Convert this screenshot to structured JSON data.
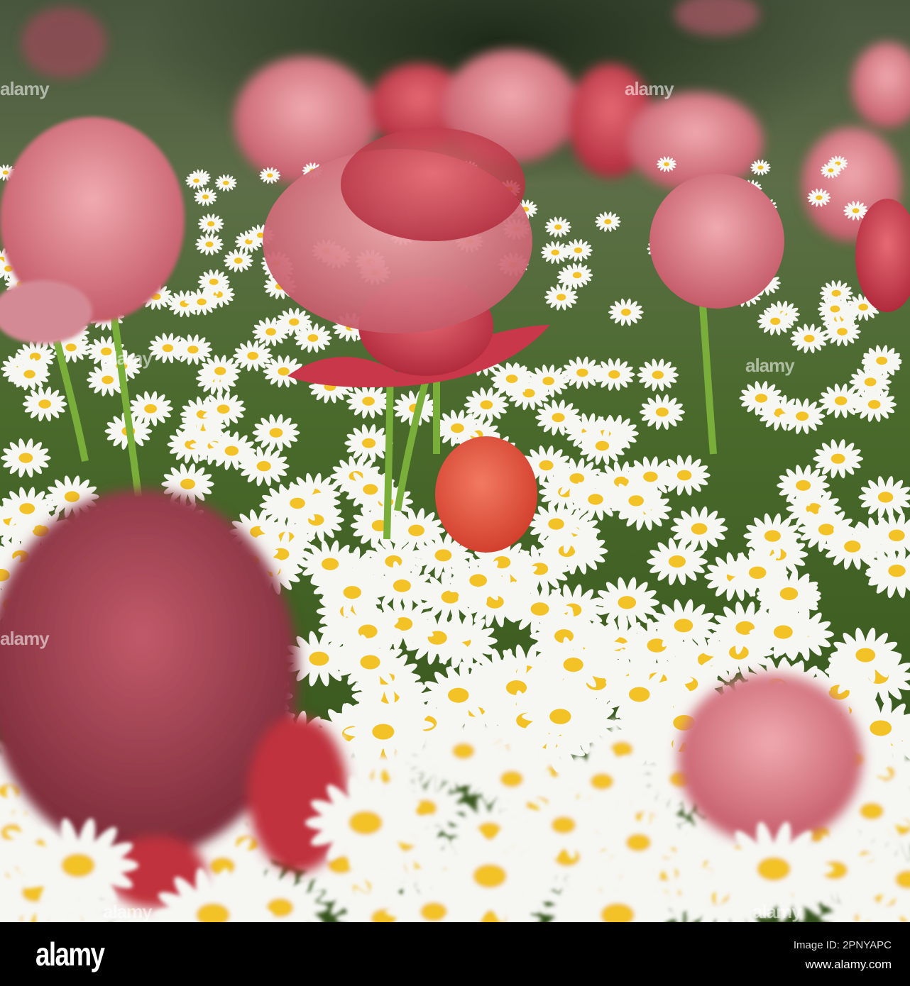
{
  "photo": {
    "subject": "tulips-and-daisies",
    "colors": {
      "tulip_pink": "#d87a86",
      "tulip_red": "#c8384a",
      "tulip_orange": "#e2533f",
      "daisy_white": "#f6f6f2",
      "daisy_center": "#f2c226",
      "foliage": "#4a6a2c"
    },
    "watermark": "alamy"
  },
  "footer": {
    "logo": "alamy",
    "image_id": "Image ID: 2PNYAPC",
    "url": "www.alamy.com"
  }
}
